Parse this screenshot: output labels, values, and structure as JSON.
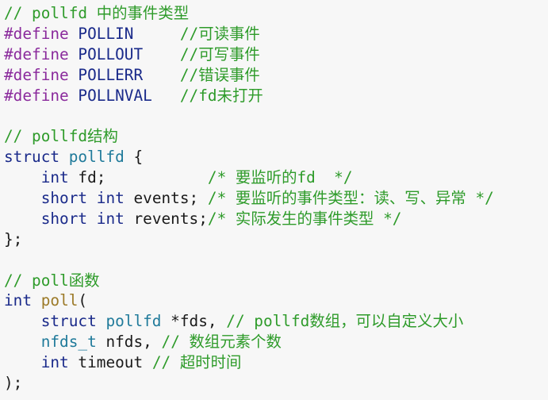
{
  "code_lines": [
    [
      [
        "comment",
        "// pollfd 中的事件类型"
      ]
    ],
    [
      [
        "directive",
        "#define"
      ],
      [
        "ws",
        " "
      ],
      [
        "macro",
        "POLLIN"
      ],
      [
        "ws",
        "     "
      ],
      [
        "comment",
        "//可读事件"
      ]
    ],
    [
      [
        "directive",
        "#define"
      ],
      [
        "ws",
        " "
      ],
      [
        "macro",
        "POLLOUT"
      ],
      [
        "ws",
        "    "
      ],
      [
        "comment",
        "//可写事件"
      ]
    ],
    [
      [
        "directive",
        "#define"
      ],
      [
        "ws",
        " "
      ],
      [
        "macro",
        "POLLERR"
      ],
      [
        "ws",
        "    "
      ],
      [
        "comment",
        "//错误事件"
      ]
    ],
    [
      [
        "directive",
        "#define"
      ],
      [
        "ws",
        " "
      ],
      [
        "macro",
        "POLLNVAL"
      ],
      [
        "ws",
        "   "
      ],
      [
        "comment",
        "//fd未打开"
      ]
    ],
    [],
    [
      [
        "comment",
        "// pollfd结构"
      ]
    ],
    [
      [
        "keyword",
        "struct"
      ],
      [
        "ws",
        " "
      ],
      [
        "type",
        "pollfd"
      ],
      [
        "ws",
        " "
      ],
      [
        "punct",
        "{"
      ]
    ],
    [
      [
        "ws",
        "    "
      ],
      [
        "keyword",
        "int"
      ],
      [
        "ws",
        " "
      ],
      [
        "ident",
        "fd"
      ],
      [
        "punct",
        ";"
      ],
      [
        "ws",
        "           "
      ],
      [
        "comment",
        "/* 要监听的fd  */"
      ]
    ],
    [
      [
        "ws",
        "    "
      ],
      [
        "keyword",
        "short"
      ],
      [
        "ws",
        " "
      ],
      [
        "keyword",
        "int"
      ],
      [
        "ws",
        " "
      ],
      [
        "ident",
        "events"
      ],
      [
        "punct",
        ";"
      ],
      [
        "ws",
        " "
      ],
      [
        "comment",
        "/* 要监听的事件类型：读、写、异常 */"
      ]
    ],
    [
      [
        "ws",
        "    "
      ],
      [
        "keyword",
        "short"
      ],
      [
        "ws",
        " "
      ],
      [
        "keyword",
        "int"
      ],
      [
        "ws",
        " "
      ],
      [
        "ident",
        "revents"
      ],
      [
        "punct",
        ";"
      ],
      [
        "comment",
        "/* 实际发生的事件类型 */"
      ]
    ],
    [
      [
        "punct",
        "};"
      ]
    ],
    [],
    [
      [
        "comment",
        "// poll函数"
      ]
    ],
    [
      [
        "keyword",
        "int"
      ],
      [
        "ws",
        " "
      ],
      [
        "func",
        "poll"
      ],
      [
        "punct",
        "("
      ]
    ],
    [
      [
        "ws",
        "    "
      ],
      [
        "keyword",
        "struct"
      ],
      [
        "ws",
        " "
      ],
      [
        "type",
        "pollfd"
      ],
      [
        "ws",
        " "
      ],
      [
        "punct",
        "*"
      ],
      [
        "ident",
        "fds"
      ],
      [
        "punct",
        ","
      ],
      [
        "ws",
        " "
      ],
      [
        "comment",
        "// pollfd数组，可以自定义大小"
      ]
    ],
    [
      [
        "ws",
        "    "
      ],
      [
        "type",
        "nfds_t"
      ],
      [
        "ws",
        " "
      ],
      [
        "ident",
        "nfds"
      ],
      [
        "punct",
        ","
      ],
      [
        "ws",
        " "
      ],
      [
        "comment",
        "// 数组元素个数"
      ]
    ],
    [
      [
        "ws",
        "    "
      ],
      [
        "keyword",
        "int"
      ],
      [
        "ws",
        " "
      ],
      [
        "ident",
        "timeout"
      ],
      [
        "ws",
        " "
      ],
      [
        "comment",
        "// 超时时间"
      ]
    ],
    [
      [
        "punct",
        ");"
      ]
    ]
  ]
}
